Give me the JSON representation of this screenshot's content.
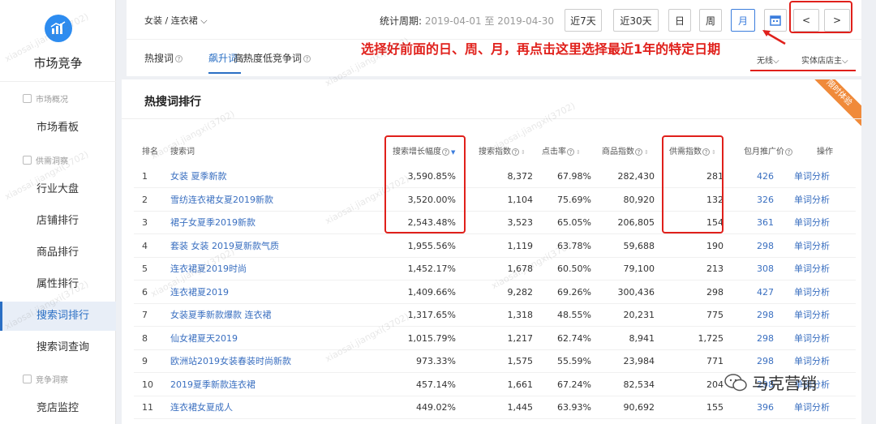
{
  "sidebar": {
    "app_title": "市场竞争",
    "sections": [
      {
        "label": "市场概况",
        "items": [
          "市场看板"
        ]
      },
      {
        "label": "供需洞察",
        "items": [
          "行业大盘",
          "店铺排行",
          "商品排行",
          "属性排行",
          "搜索词排行",
          "搜索词查询"
        ]
      },
      {
        "label": "竞争洞察",
        "items": [
          "竞店监控"
        ]
      }
    ],
    "active_item": "搜索词排行"
  },
  "topbar": {
    "category": "女装 / 连衣裙",
    "period_label": "统计周期:",
    "period_value": "2019-04-01 至 2019-04-30",
    "buttons": [
      "近7天",
      "近30天",
      "日",
      "周",
      "月"
    ],
    "selected_button": "月",
    "prev": "<",
    "next": ">"
  },
  "tabs": {
    "items": [
      "热搜词",
      "飙升词",
      "高热度低竞争词"
    ],
    "active": "飙升词",
    "filters": [
      "无线",
      "实体店店主"
    ]
  },
  "annotation": "选择好前面的日、周、月，再点击这里选择最近1年的特定日期",
  "card": {
    "title": "热搜词排行",
    "ribbon": "限时体验",
    "headers": [
      "排名",
      "搜索词",
      "搜索增长幅度",
      "搜索指数",
      "点击率",
      "商品指数",
      "供需指数",
      "包月推广价",
      "操作"
    ],
    "rows": [
      {
        "rank": "1",
        "keyword": "女装 夏季新款",
        "growth": "3,590.85%",
        "search": "8,372",
        "ctr": "67.98%",
        "goods": "282,430",
        "supply": "281",
        "price": "426",
        "action": "单词分析"
      },
      {
        "rank": "2",
        "keyword": "雪纺连衣裙女夏2019新款",
        "growth": "3,520.00%",
        "search": "1,104",
        "ctr": "75.69%",
        "goods": "80,920",
        "supply": "132",
        "price": "326",
        "action": "单词分析"
      },
      {
        "rank": "3",
        "keyword": "裙子女夏季2019新款",
        "growth": "2,543.48%",
        "search": "3,523",
        "ctr": "65.05%",
        "goods": "206,805",
        "supply": "154",
        "price": "361",
        "action": "单词分析"
      },
      {
        "rank": "4",
        "keyword": "套装 女装 2019夏新款气质",
        "growth": "1,955.56%",
        "search": "1,119",
        "ctr": "63.78%",
        "goods": "59,688",
        "supply": "190",
        "price": "298",
        "action": "单词分析"
      },
      {
        "rank": "5",
        "keyword": "连衣裙夏2019时尚",
        "growth": "1,452.17%",
        "search": "1,678",
        "ctr": "60.50%",
        "goods": "79,100",
        "supply": "213",
        "price": "308",
        "action": "单词分析"
      },
      {
        "rank": "6",
        "keyword": "连衣裙夏2019",
        "growth": "1,409.66%",
        "search": "9,282",
        "ctr": "69.26%",
        "goods": "300,436",
        "supply": "298",
        "price": "427",
        "action": "单词分析"
      },
      {
        "rank": "7",
        "keyword": "女装夏季新款爆款 连衣裙",
        "growth": "1,317.65%",
        "search": "1,318",
        "ctr": "48.55%",
        "goods": "20,231",
        "supply": "775",
        "price": "298",
        "action": "单词分析"
      },
      {
        "rank": "8",
        "keyword": "仙女裙夏天2019",
        "growth": "1,015.79%",
        "search": "1,217",
        "ctr": "62.74%",
        "goods": "8,941",
        "supply": "1,725",
        "price": "298",
        "action": "单词分析"
      },
      {
        "rank": "9",
        "keyword": "欧洲站2019女装春装时尚新款",
        "growth": "973.33%",
        "search": "1,575",
        "ctr": "55.59%",
        "goods": "23,984",
        "supply": "771",
        "price": "298",
        "action": "单词分析"
      },
      {
        "rank": "10",
        "keyword": "2019夏季新款连衣裙",
        "growth": "457.14%",
        "search": "1,661",
        "ctr": "67.24%",
        "goods": "82,534",
        "supply": "204",
        "price": "298",
        "action": "单词分析"
      },
      {
        "rank": "11",
        "keyword": "连衣裙女夏成人",
        "growth": "449.02%",
        "search": "1,445",
        "ctr": "63.93%",
        "goods": "90,692",
        "supply": "155",
        "price": "396",
        "action": "单词分析"
      }
    ]
  },
  "watermark_text": "xiaosai.jiangxi(3702)",
  "brand": "马克营销",
  "colors": {
    "accent": "#2a6fc4",
    "annotation": "#e0201b",
    "ribbon": "#f08a3a"
  }
}
